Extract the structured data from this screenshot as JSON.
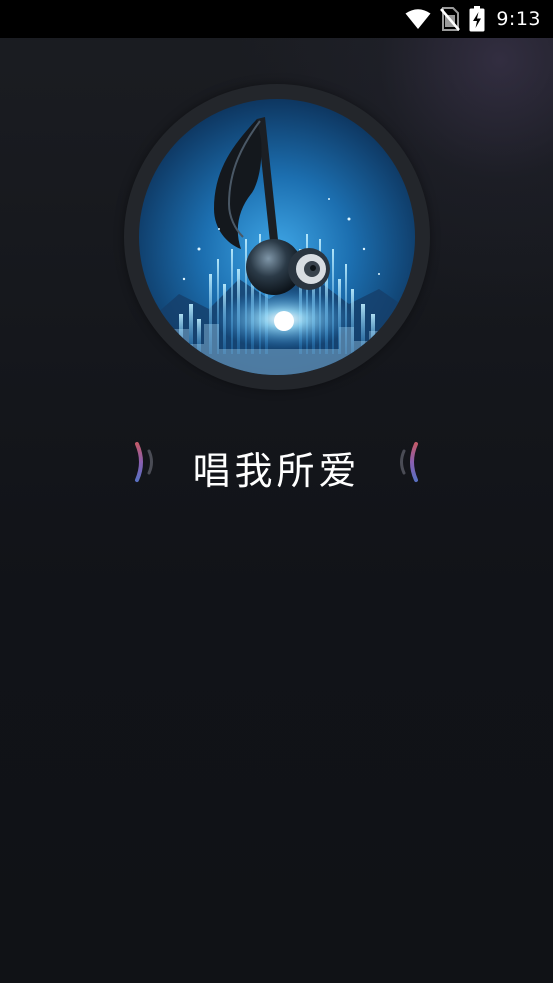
{
  "status_bar": {
    "time": "9:13",
    "icons": [
      "wifi-icon",
      "no-sim-icon",
      "battery-charging-icon"
    ]
  },
  "app": {
    "title": "唱我所爱",
    "cover_icon": "music-note-speaker-image"
  },
  "colors": {
    "background": "#111318",
    "title_text": "#ffffff",
    "wave_accent": "#8a5fb0",
    "cover_blue": "#1a7fc4"
  }
}
